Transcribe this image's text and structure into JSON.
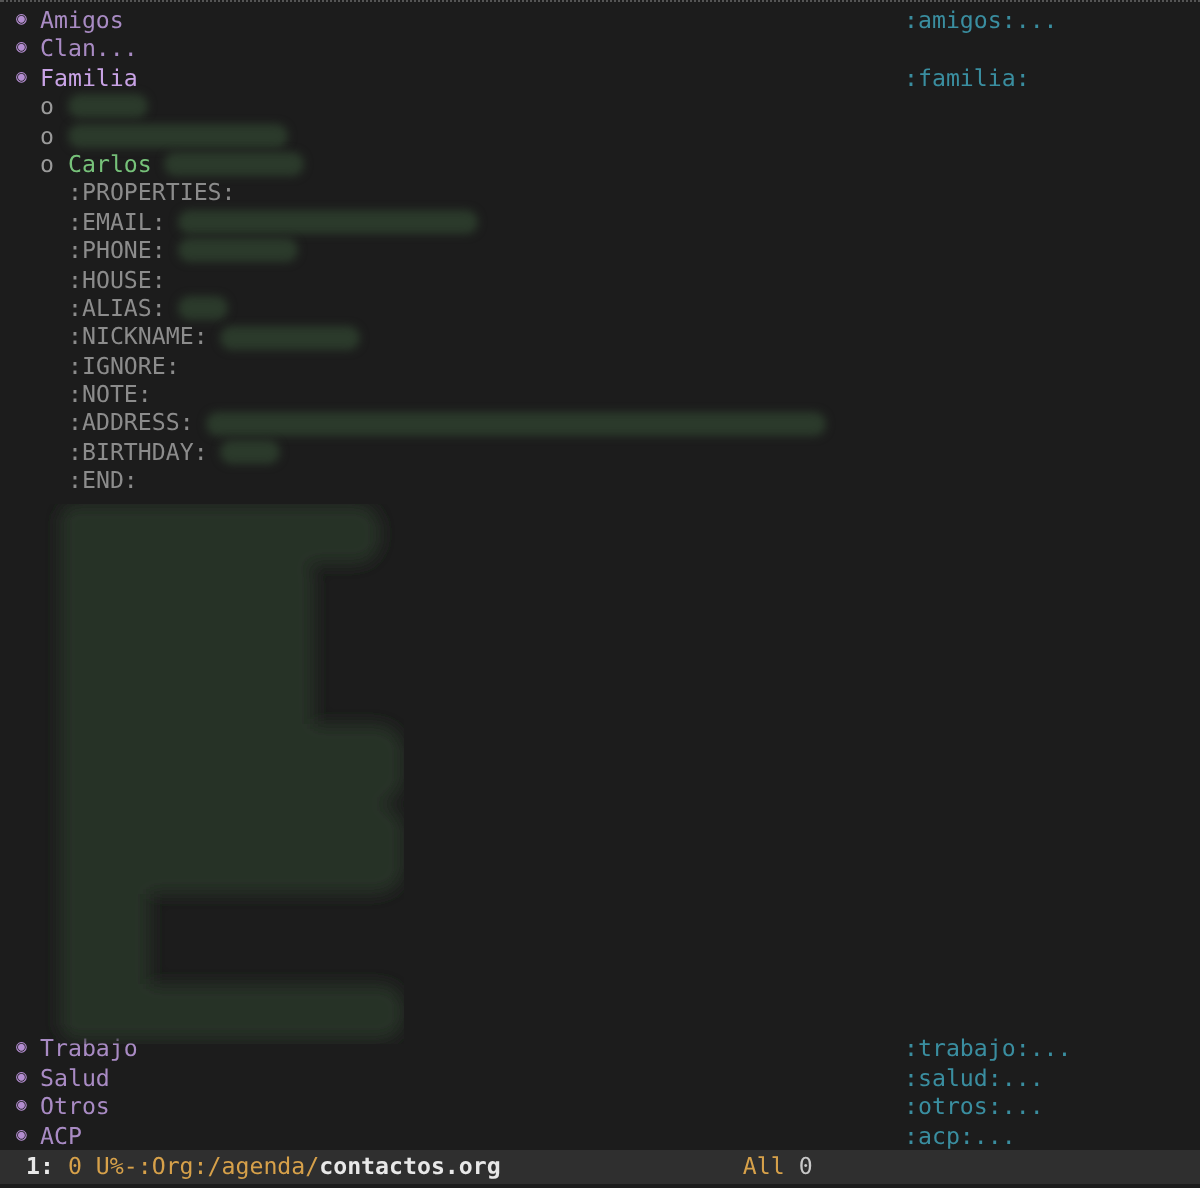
{
  "top_headings": [
    {
      "bullet": "◉",
      "title": "Amigos",
      "tags": ":amigos:...",
      "expanded": false
    },
    {
      "bullet": "◉",
      "title": "Clan...",
      "expanded": false
    },
    {
      "bullet": "◉",
      "title": "Familia",
      "tags": ":familia:",
      "expanded": true,
      "items": [
        {
          "bullet": "o",
          "redacted": true
        },
        {
          "bullet": "o",
          "redacted": true
        },
        {
          "bullet": "o",
          "name": "Carlos",
          "redacted": true,
          "properties": [
            {
              "key": ":PROPERTIES:"
            },
            {
              "key": ":EMAIL:",
              "redacted": true
            },
            {
              "key": ":PHONE:",
              "redacted": true
            },
            {
              "key": ":HOUSE:"
            },
            {
              "key": ":ALIAS:",
              "redacted": true
            },
            {
              "key": ":NICKNAME:",
              "redacted": true
            },
            {
              "key": ":IGNORE:"
            },
            {
              "key": ":NOTE:"
            },
            {
              "key": ":ADDRESS:",
              "redacted": true
            },
            {
              "key": ":BIRTHDAY:",
              "redacted": true
            },
            {
              "key": ":END:"
            }
          ]
        }
      ]
    }
  ],
  "bottom_headings": [
    {
      "bullet": "◉",
      "title": "Trabajo",
      "tags": ":trabajo:...",
      "expanded": false
    },
    {
      "bullet": "◉",
      "title": "Salud",
      "tags": ":salud:...",
      "expanded": false
    },
    {
      "bullet": "◉",
      "title": "Otros",
      "tags": ":otros:...",
      "expanded": false
    },
    {
      "bullet": "◉",
      "title": "ACP",
      "tags": ":acp:...",
      "expanded": false
    }
  ],
  "mode_line": {
    "window": "1:",
    "state": "0 U%-:Org:/agenda/",
    "file": "contactos.org",
    "position": "All",
    "column": "0"
  }
}
